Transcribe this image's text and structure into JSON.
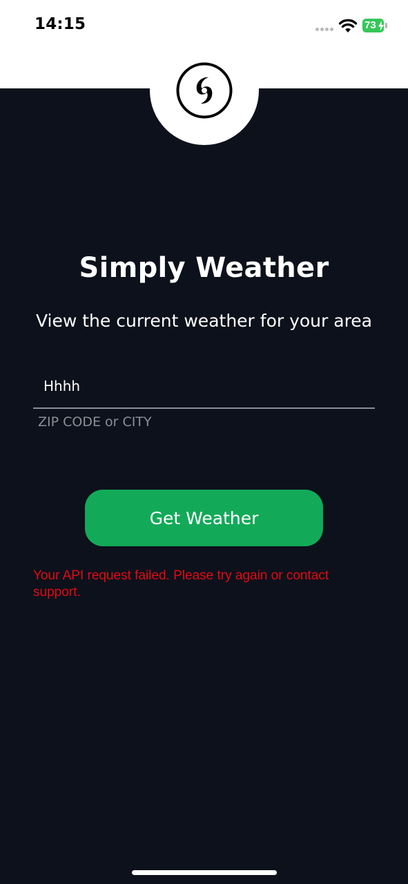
{
  "status_bar": {
    "time": "14:15",
    "battery_level": "73",
    "icons": [
      "signal-icon",
      "wifi-icon",
      "battery-icon",
      "charging-bolt-icon"
    ]
  },
  "logo": {
    "icon": "hurricane-icon"
  },
  "main": {
    "title": "Simply Weather",
    "subtitle": "View the current weather for your area",
    "location_input": {
      "value": "Hhhh",
      "helper_text": "ZIP CODE or CITY"
    },
    "get_weather_label": "Get Weather",
    "error_message": "Your API request failed. Please try again or contact support."
  },
  "colors": {
    "background": "#0c111b",
    "button": "#12aa58",
    "error": "#e50914",
    "battery": "#33c759"
  }
}
